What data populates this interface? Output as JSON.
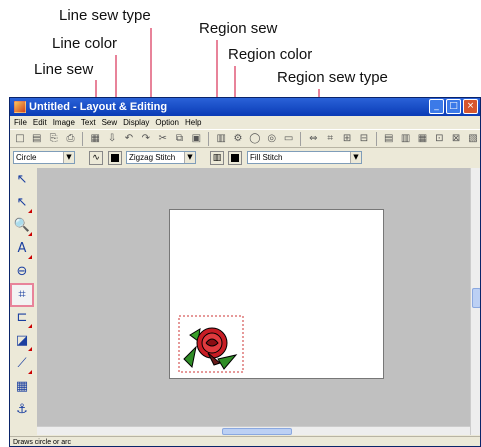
{
  "callouts": {
    "line_sew_type": "Line sew type",
    "line_color": "Line color",
    "line_sew": "Line sew",
    "region_sew": "Region sew",
    "region_color": "Region color",
    "region_sew_type": "Region sew type"
  },
  "window": {
    "title": "Untitled - Layout & Editing",
    "title_buttons": [
      "_",
      "□",
      "×"
    ]
  },
  "menu": [
    "File",
    "Edit",
    "Image",
    "Text",
    "Sew",
    "Display",
    "Option",
    "Help"
  ],
  "toolbar1_icons": [
    "□",
    "▤",
    "⎘",
    "⎙",
    "▦",
    "⇩",
    "↶",
    "↷",
    "✂",
    "⧉",
    "▣",
    "▥",
    "⚙",
    "◯",
    "◎",
    "▭",
    "⇔",
    "⌗",
    "⊞",
    "⊟",
    "▤",
    "▥",
    "▦",
    "⊡",
    "⊠",
    "▧"
  ],
  "toolbar2": {
    "shape_select": "Circle",
    "line_sew_type": "Zigzag Stitch",
    "region_sew_type": "Fill Stitch"
  },
  "tools": [
    "↖",
    "↖",
    "🔍",
    "A",
    "⊖",
    "⌗",
    "⊏",
    "◪",
    "⟋",
    "▦",
    "⚓"
  ],
  "colors": {
    "callout_line": "#e8839a",
    "title_bar": "#0a3bb5",
    "workspace": "#c0c0c0"
  },
  "status": "Draws circle or arc"
}
